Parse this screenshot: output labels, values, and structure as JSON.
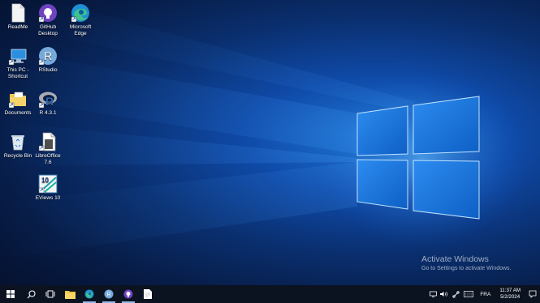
{
  "desktop": {
    "icons": [
      {
        "label": "ReadMe"
      },
      {
        "label": "GitHub\nDesktop"
      },
      {
        "label": "Microsoft\nEdge"
      },
      {
        "label": "This PC -\nShortcut"
      },
      {
        "label": "RStudio"
      },
      {
        "label": "Documents"
      },
      {
        "label": "R 4.3.1"
      },
      {
        "label": "Recycle Bin"
      },
      {
        "label": "LibreOffice\n7.6"
      },
      {
        "label": "EViews 10"
      }
    ]
  },
  "watermark": {
    "title": "Activate Windows",
    "subtitle": "Go to Settings to activate Windows."
  },
  "taskbar": {
    "language": "FRA",
    "time": "11:37 AM",
    "date": "5/2/2024"
  },
  "colors": {
    "taskbar_bg": "#0b1220",
    "active_indicator": "#8fb8ef"
  }
}
